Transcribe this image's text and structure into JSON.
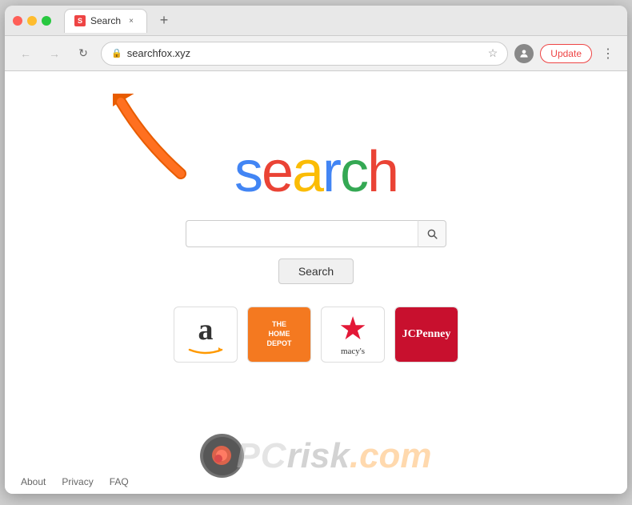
{
  "browser": {
    "title": "Search",
    "url": "searchfox.xyz",
    "tab_label": "Search",
    "update_label": "Update",
    "nav": {
      "back_title": "Back",
      "forward_title": "Forward",
      "reload_title": "Reload"
    }
  },
  "page": {
    "logo_letters": [
      "s",
      "e",
      "a",
      "r",
      "c",
      "h"
    ],
    "search_placeholder": "",
    "search_button_label": "Search",
    "shortcuts": [
      {
        "name": "Amazon",
        "type": "amazon"
      },
      {
        "name": "The Home Depot",
        "type": "homedepot"
      },
      {
        "name": "Macy's",
        "type": "macys"
      },
      {
        "name": "JCPenney",
        "type": "jcpenney"
      }
    ],
    "footer_links": [
      "About",
      "Privacy",
      "FAQ"
    ]
  }
}
